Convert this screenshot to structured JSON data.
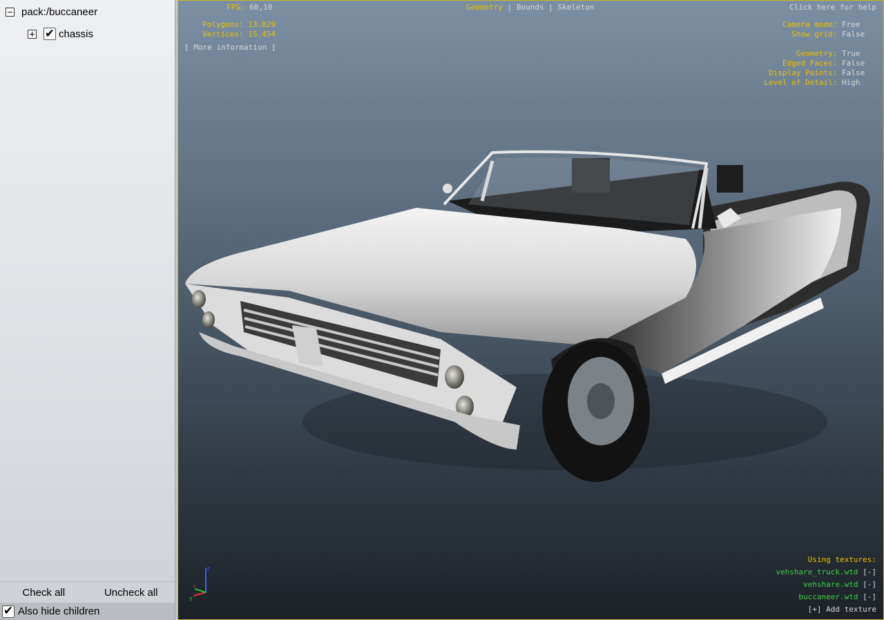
{
  "tree": {
    "root": {
      "label": "pack:/buccaneer",
      "expanded": true
    },
    "children": [
      {
        "label": "chassis",
        "checked": true,
        "expanded": false
      }
    ]
  },
  "panel_buttons": {
    "check_all": "Check all",
    "uncheck_all": "Uncheck all"
  },
  "hide_children": {
    "label": "Also hide children",
    "checked": true
  },
  "stats": {
    "fps_label": "FPS:",
    "fps_value": "60,10",
    "polygons_label": "Polygons:",
    "polygons_value": "13.829",
    "vertices_label": "Vertices:",
    "vertices_value": "15.454",
    "more_info": "[ More information ]"
  },
  "view_modes": {
    "geometry": "Geometry",
    "bounds": "Bounds",
    "skeleton": "Skeleton",
    "separator": "|",
    "active": "Geometry"
  },
  "help": "Click here for help",
  "settings": [
    {
      "label": "Camera mode:",
      "value": "Free"
    },
    {
      "label": "Show grid:",
      "value": "False"
    },
    {
      "label": "Geometry:",
      "value": "True"
    },
    {
      "label": "Edged Faces:",
      "value": "False"
    },
    {
      "label": "Display Points:",
      "value": "False"
    },
    {
      "label": "Level of Detail:",
      "value": "High"
    }
  ],
  "textures": {
    "heading": "Using textures:",
    "items": [
      {
        "name": "vehshare_truck.wtd",
        "remove": "[-]"
      },
      {
        "name": "vehshare.wtd",
        "remove": "[-]"
      },
      {
        "name": "buccaneer.wtd",
        "remove": "[-]"
      }
    ],
    "add": "[+] Add texture"
  },
  "axis": {
    "z": "z",
    "x": "x",
    "y": "y"
  },
  "colors": {
    "accent_yellow": "#e8c000",
    "texture_green": "#3ecf4a",
    "light_text": "#d8d8d8"
  }
}
